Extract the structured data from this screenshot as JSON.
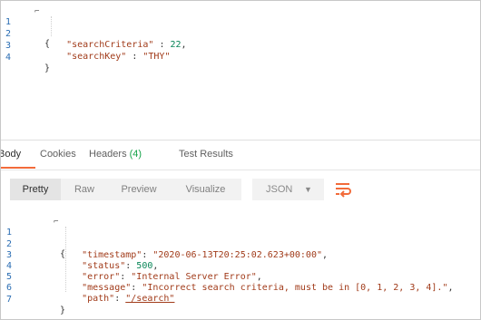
{
  "request_body": {
    "lines": [
      {
        "no": "1",
        "parts": [
          {
            "t": "{",
            "c": "pun"
          }
        ]
      },
      {
        "no": "2",
        "parts": [
          {
            "t": "    \"searchCriteria\"",
            "c": "str"
          },
          {
            "t": " : ",
            "c": "pun"
          },
          {
            "t": "22",
            "c": "num"
          },
          {
            "t": ",",
            "c": "pun"
          }
        ]
      },
      {
        "no": "3",
        "parts": [
          {
            "t": "    \"searchKey\"",
            "c": "str"
          },
          {
            "t": " : ",
            "c": "pun"
          },
          {
            "t": "\"THY\"",
            "c": "str"
          }
        ]
      },
      {
        "no": "4",
        "parts": [
          {
            "t": "}",
            "c": "pun"
          }
        ]
      }
    ]
  },
  "response_tabs": {
    "body": "Body",
    "cookies": "Cookies",
    "headers": "Headers",
    "headers_count": "(4)",
    "test_results": "Test Results"
  },
  "view_toolbar": {
    "pretty": "Pretty",
    "raw": "Raw",
    "preview": "Preview",
    "visualize": "Visualize",
    "format": "JSON",
    "format_caret": "▼",
    "wrap_icon": "wrap-lines-icon",
    "accent_color": "#f26b3a"
  },
  "response_body": {
    "lines": [
      {
        "no": "1",
        "parts": [
          {
            "t": "{",
            "c": "pun"
          }
        ]
      },
      {
        "no": "2",
        "parts": [
          {
            "t": "    \"timestamp\"",
            "c": "str"
          },
          {
            "t": ": ",
            "c": "pun"
          },
          {
            "t": "\"2020-06-13T20:25:02.623+00:00\"",
            "c": "str"
          },
          {
            "t": ",",
            "c": "pun"
          }
        ]
      },
      {
        "no": "3",
        "parts": [
          {
            "t": "    \"status\"",
            "c": "str"
          },
          {
            "t": ": ",
            "c": "pun"
          },
          {
            "t": "500",
            "c": "num"
          },
          {
            "t": ",",
            "c": "pun"
          }
        ]
      },
      {
        "no": "4",
        "parts": [
          {
            "t": "    \"error\"",
            "c": "str"
          },
          {
            "t": ": ",
            "c": "pun"
          },
          {
            "t": "\"Internal Server Error\"",
            "c": "str"
          },
          {
            "t": ",",
            "c": "pun"
          }
        ]
      },
      {
        "no": "5",
        "parts": [
          {
            "t": "    \"message\"",
            "c": "str"
          },
          {
            "t": ": ",
            "c": "pun"
          },
          {
            "t": "\"Incorrect search criteria, must be in [0, 1, 2, 3, 4].\"",
            "c": "str"
          },
          {
            "t": ",",
            "c": "pun"
          }
        ]
      },
      {
        "no": "6",
        "parts": [
          {
            "t": "    \"path\"",
            "c": "str"
          },
          {
            "t": ": ",
            "c": "pun"
          },
          {
            "t": "\"/search\"",
            "c": "str url"
          }
        ]
      },
      {
        "no": "7",
        "parts": [
          {
            "t": "}",
            "c": "pun"
          }
        ]
      }
    ]
  }
}
